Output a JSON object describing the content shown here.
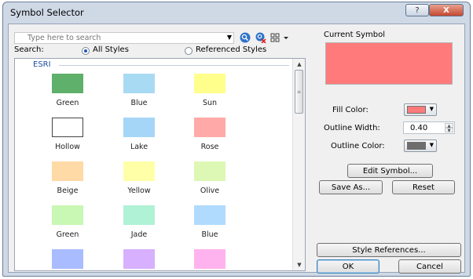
{
  "window": {
    "title": "Symbol Selector",
    "help_label": "?",
    "close_label": "X"
  },
  "search": {
    "placeholder": "Type here to search",
    "label": "Search:"
  },
  "scope": {
    "all_styles": "All Styles",
    "referenced_styles": "Referenced Styles",
    "selected": "All Styles"
  },
  "gallery": {
    "category": "ESRI",
    "symbols": [
      {
        "name": "Green",
        "color": "#5fb06a"
      },
      {
        "name": "Blue",
        "color": "#a9daf3"
      },
      {
        "name": "Sun",
        "color": "#ffff8c"
      },
      {
        "name": "Hollow",
        "color": "#ffffff"
      },
      {
        "name": "Lake",
        "color": "#a6d6f7"
      },
      {
        "name": "Rose",
        "color": "#ffaaa8"
      },
      {
        "name": "Beige",
        "color": "#ffd9a6"
      },
      {
        "name": "Yellow",
        "color": "#ffffa8"
      },
      {
        "name": "Olive",
        "color": "#ddf7b4"
      },
      {
        "name": "Green",
        "color": "#c9f7b4"
      },
      {
        "name": "Jade",
        "color": "#b0f2d6"
      },
      {
        "name": "Blue",
        "color": "#b0dbff"
      },
      {
        "name": "",
        "color": "#a9bcff"
      },
      {
        "name": "",
        "color": "#d7b0ff"
      },
      {
        "name": "",
        "color": "#ffb3ee"
      }
    ]
  },
  "current_symbol": {
    "heading": "Current Symbol",
    "preview_color": "#ff7b7b",
    "fill_color_label": "Fill Color:",
    "fill_color": "#ff7b7b",
    "outline_width_label": "Outline Width:",
    "outline_width": "0.40",
    "outline_color_label": "Outline Color:",
    "outline_color": "#6e6e6e"
  },
  "buttons": {
    "edit_symbol": "Edit Symbol...",
    "save_as": "Save As...",
    "reset": "Reset",
    "style_references": "Style References...",
    "ok": "OK",
    "cancel": "Cancel"
  }
}
